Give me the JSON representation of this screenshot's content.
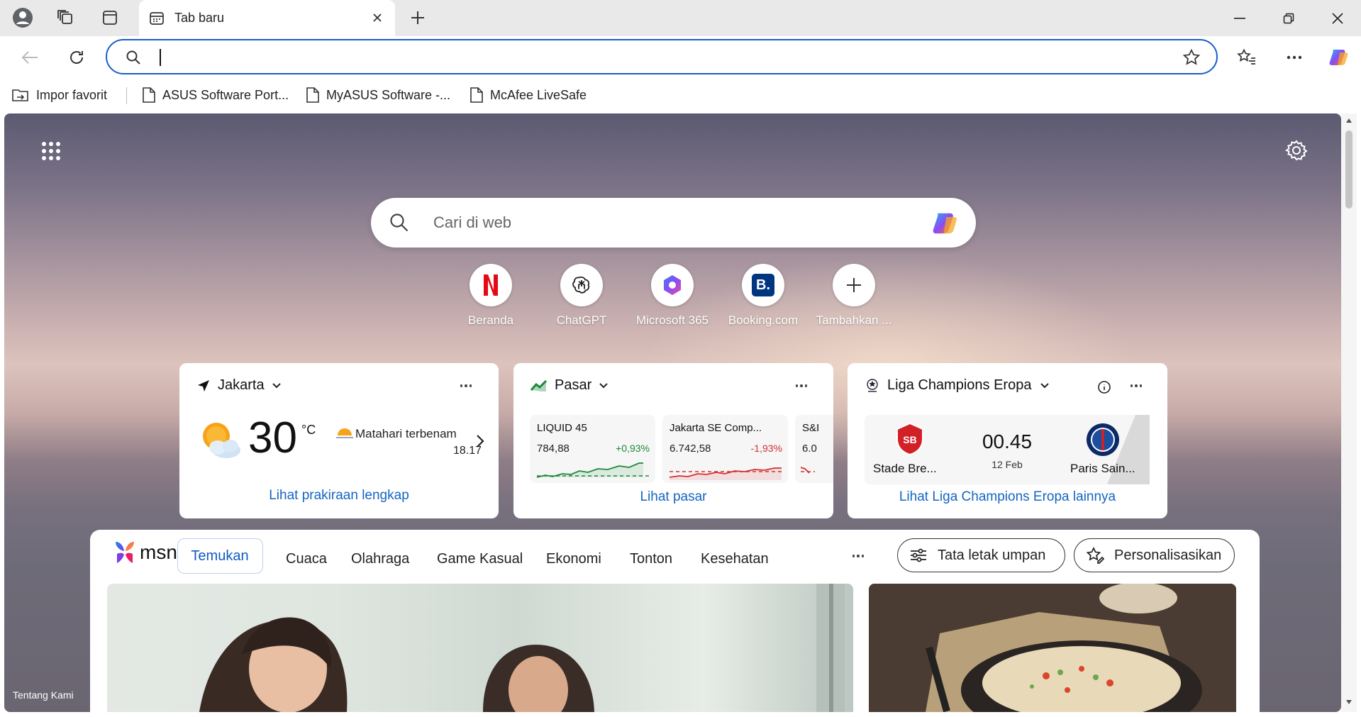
{
  "tab": {
    "title": "Tab baru"
  },
  "bookmarks": [
    {
      "label": "Impor favorit"
    },
    {
      "label": "ASUS Software Port..."
    },
    {
      "label": "MyASUS Software -..."
    },
    {
      "label": "McAfee LiveSafe"
    }
  ],
  "search": {
    "placeholder": "Cari di web"
  },
  "quick_links": [
    {
      "label": "Beranda",
      "icon": "netflix-icon"
    },
    {
      "label": "ChatGPT",
      "icon": "chatgpt-icon"
    },
    {
      "label": "Microsoft 365",
      "icon": "microsoft365-icon"
    },
    {
      "label": "Booking.com",
      "icon": "booking-icon"
    },
    {
      "label": "Tambahkan ...",
      "icon": "plus-icon"
    }
  ],
  "weather": {
    "location": "Jakarta",
    "temp": "30",
    "unit": "°C",
    "sunset_label": "Matahari terbenam",
    "sunset_time": "18.17",
    "link": "Lihat prakiraan lengkap"
  },
  "market": {
    "title": "Pasar",
    "items": [
      {
        "name": "LIQUID 45",
        "value": "784,88",
        "change": "+0,93%",
        "trend": "up"
      },
      {
        "name": "Jakarta SE Comp...",
        "value": "6.742,58",
        "change": "-1,93%",
        "trend": "down"
      },
      {
        "name": "S&I",
        "value": "6.0",
        "change": "",
        "trend": "down"
      }
    ],
    "link": "Lihat pasar"
  },
  "sports": {
    "title": "Liga Champions Eropa",
    "home_team": "Stade Bre...",
    "away_team": "Paris Sain...",
    "time": "00.45",
    "date": "12 Feb",
    "link": "Lihat Liga Champions Eropa lainnya"
  },
  "feed": {
    "brand": "msn",
    "tabs": [
      "Temukan",
      "Cuaca",
      "Olahraga",
      "Game Kasual",
      "Ekonomi",
      "Tonton",
      "Kesehatan"
    ],
    "layout_button": "Tata letak umpan",
    "personalize_button": "Personalisasikan"
  },
  "footer": {
    "about": "Tentang Kami"
  },
  "colors": {
    "accent": "#1a5fc7",
    "link": "#1565c0",
    "up": "#1b8a3a",
    "down": "#d32f2f"
  }
}
